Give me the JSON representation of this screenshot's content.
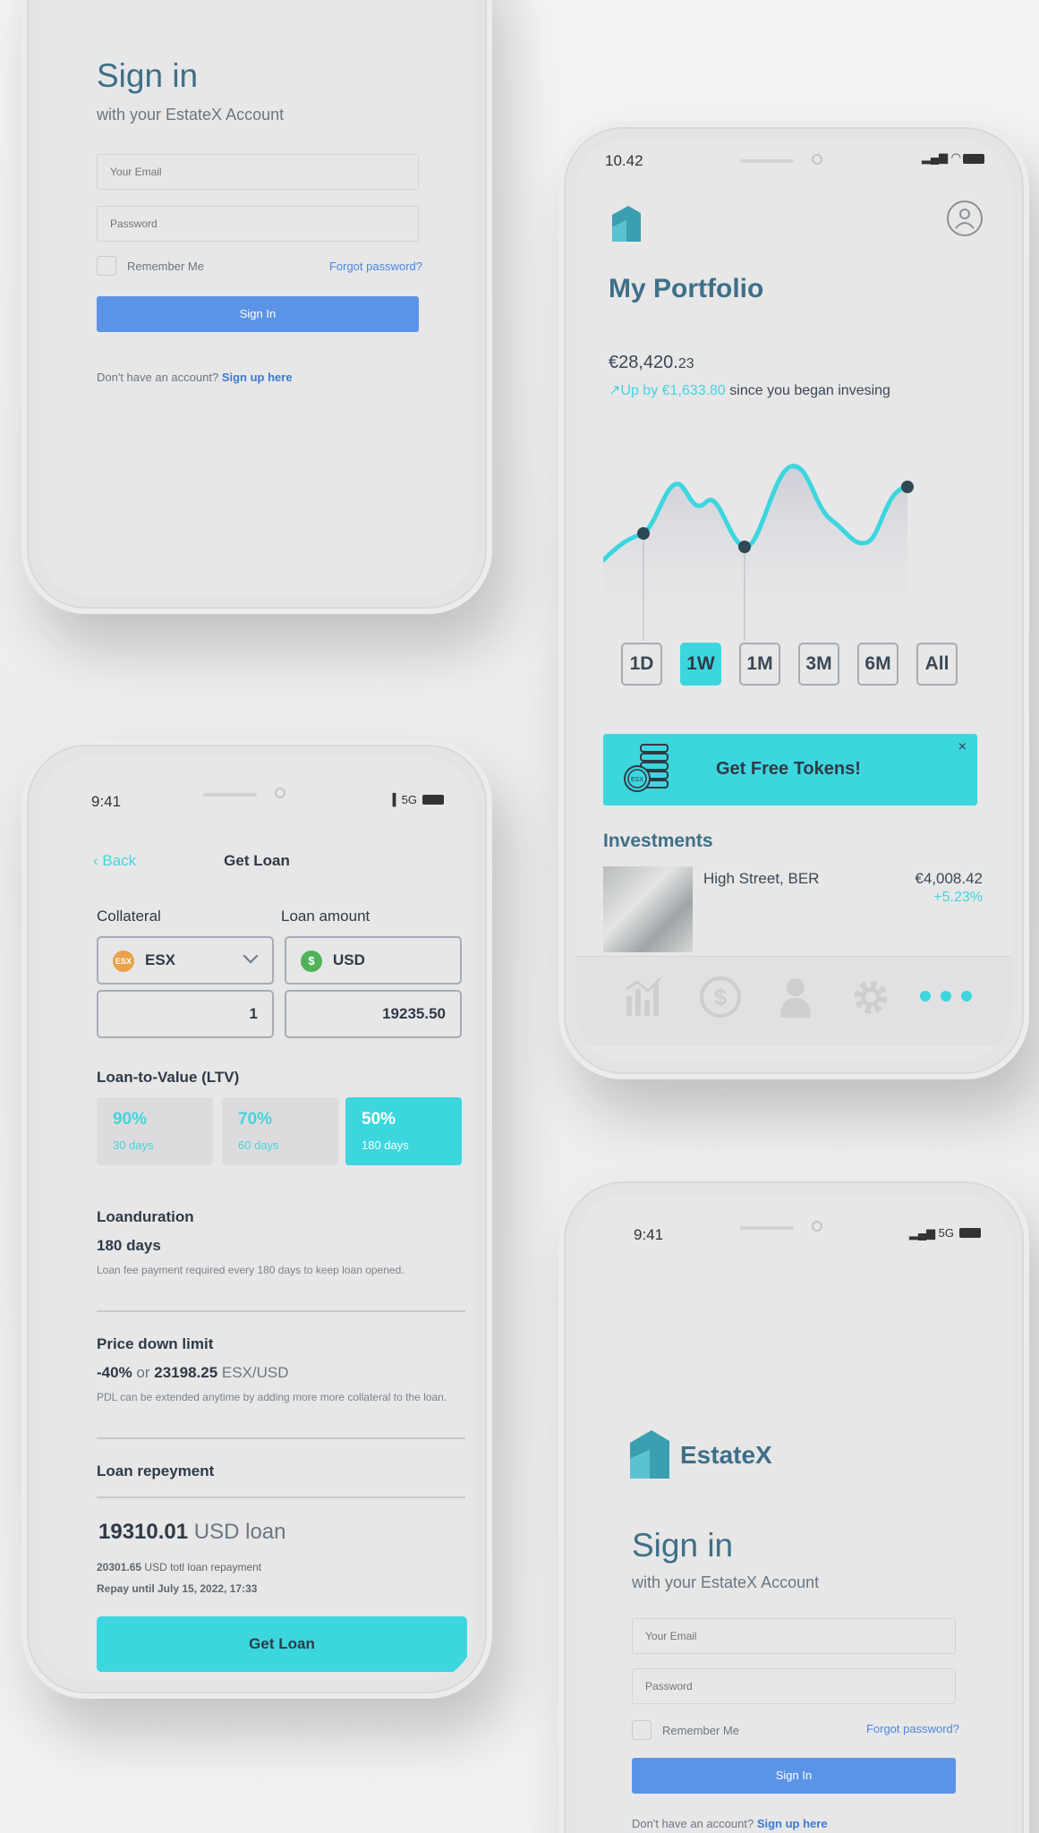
{
  "signin_top": {
    "title": "Sign in",
    "subtitle": "with your EstateX Account",
    "email_placeholder": "Your Email",
    "password_placeholder": "Password",
    "remember": "Remember Me",
    "forgot": "Forgot password?",
    "button": "Sign In",
    "no_account": "Don't have an account?",
    "signup": "Sign up here"
  },
  "portfolio": {
    "status_time": "10.42",
    "title": "My Portfolio",
    "value_main": "€28,420.",
    "value_cents": "23",
    "gain_up": "↗Up by €1,633.80",
    "gain_rest": " since you began invesing",
    "ranges": [
      "1D",
      "1W",
      "1M",
      "3M",
      "6M",
      "All"
    ],
    "active_range": "1W",
    "promo_text": "Get Free Tokens!",
    "promo_close": "×",
    "coin_label": "ESX",
    "investments_title": "Investments",
    "investment": {
      "name": "High Street, BER",
      "value": "€4,008.42",
      "change": "+5.23%"
    },
    "tabs": [
      "chart-icon",
      "dollar-icon",
      "user-icon",
      "gear-icon",
      "more-icon"
    ]
  },
  "loan": {
    "status_time": "9:41",
    "status_signal": "5G",
    "back": "Back",
    "title": "Get Loan",
    "collateral_label": "Collateral",
    "loan_amount_label": "Loan amount",
    "collateral_currency": "ESX",
    "collateral_coin": "ESX",
    "loan_currency": "USD",
    "loan_coin": "$",
    "collateral_amount": "1",
    "loan_amount": "19235.50",
    "ltv_label": "Loan-to-Value (LTV)",
    "ltv": [
      {
        "percent": "90%",
        "days": "30 days"
      },
      {
        "percent": "70%",
        "days": "60 days"
      },
      {
        "percent": "50%",
        "days": "180 days"
      }
    ],
    "duration_label": "Loanduration",
    "duration_value": "180 days",
    "duration_note": "Loan fee payment required every 180 days to keep loan opened.",
    "pdl_label": "Price down limit",
    "pdl_percent": "-40%",
    "pdl_or": " or ",
    "pdl_value": "23198.25",
    "pdl_pair": " ESX/USD",
    "pdl_note": "PDL can be extended anytime by adding more more collateral to the loan.",
    "repayment_label": "Loan repeyment",
    "total_amount": "19310.01",
    "total_unit": " USD loan",
    "total_repay_amount": "20301.65",
    "total_repay_rest": " USD totl loan repayment",
    "repay_until": "Repay until July 15, 2022, 17:33",
    "button": "Get Loan"
  },
  "signin_bottom": {
    "status_time": "9:41",
    "status_signal": "5G",
    "brand": "EstateX",
    "title": "Sign in",
    "subtitle": "with your EstateX Account",
    "email_placeholder": "Your Email",
    "password_placeholder": "Password",
    "remember": "Remember Me",
    "forgot": "Forgot password?",
    "button": "Sign In",
    "no_account": "Don't have an account?",
    "signup": "Sign up here"
  },
  "colors": {
    "accent": "#3cd6df",
    "brand": "#3e6f87",
    "link": "#4a86e0",
    "button": "#5b93e6"
  }
}
